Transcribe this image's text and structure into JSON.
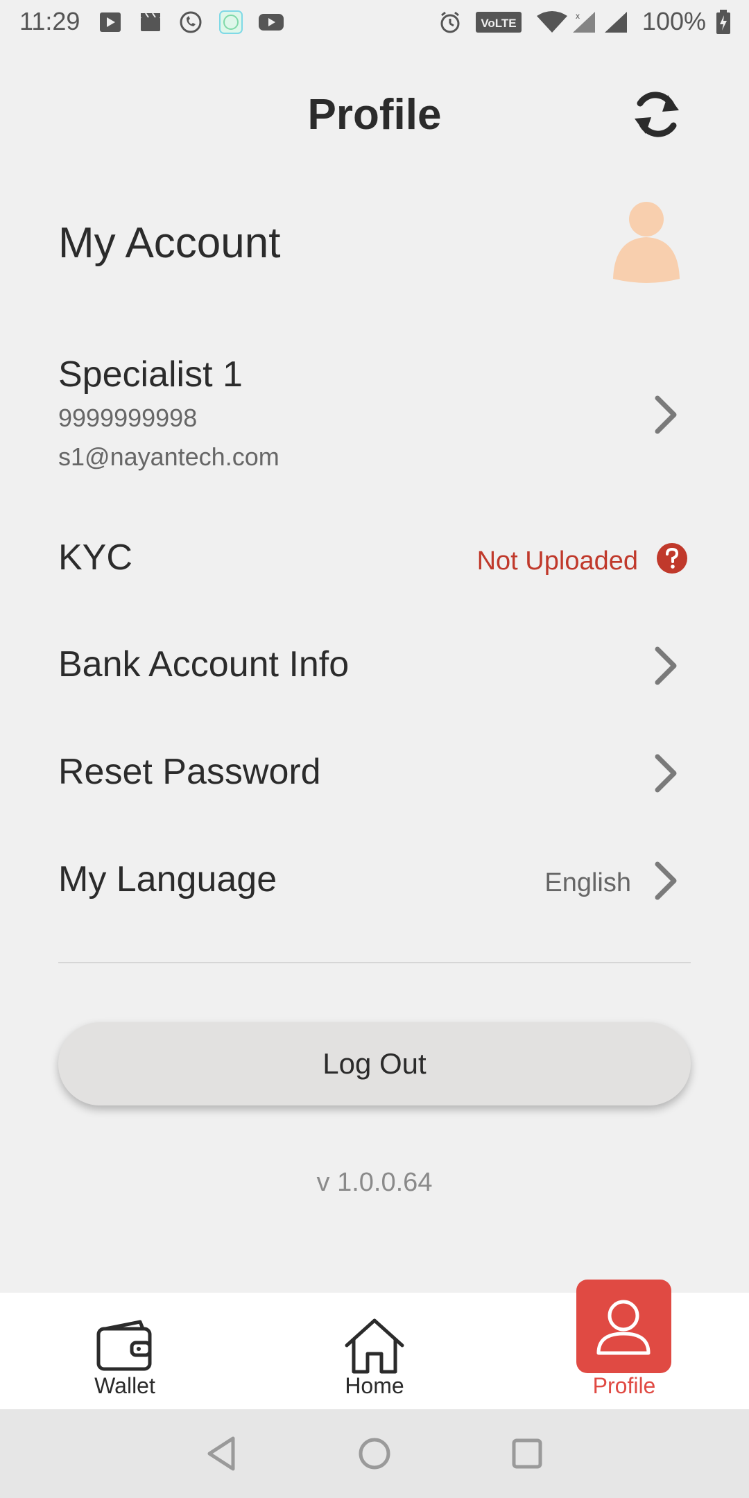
{
  "status_bar": {
    "time": "11:29",
    "battery": "100%",
    "volte": "VoLTE"
  },
  "header": {
    "title": "Profile"
  },
  "account": {
    "section_title": "My Account",
    "name": "Specialist 1",
    "phone": "9999999998",
    "email": "s1@nayantech.com"
  },
  "menu": {
    "kyc_label": "KYC",
    "kyc_status": "Not Uploaded",
    "bank_label": "Bank Account Info",
    "reset_label": "Reset Password",
    "language_label": "My Language",
    "language_value": "English"
  },
  "logout_label": "Log Out",
  "version": "v 1.0.0.64",
  "bottom_nav": {
    "wallet": "Wallet",
    "home": "Home",
    "profile": "Profile"
  },
  "colors": {
    "accent": "#e04a43",
    "kyc_status": "#c0392b",
    "avatar": "#f8cfae"
  },
  "icons": {
    "refresh": "refresh-icon",
    "avatar": "user-avatar-icon",
    "chevron": "chevron-right-icon",
    "help": "help-circle-icon",
    "wallet": "wallet-icon",
    "home": "home-icon",
    "profile": "profile-icon"
  }
}
